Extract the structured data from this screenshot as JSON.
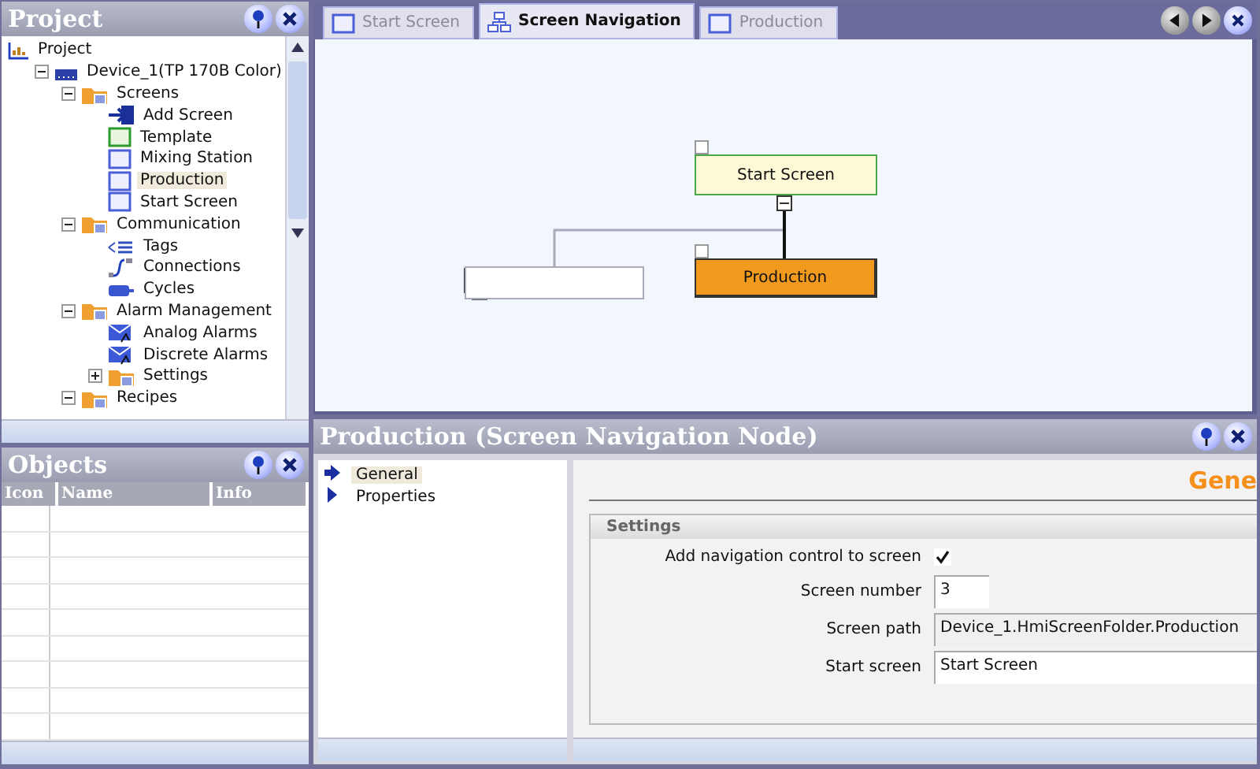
{
  "project_panel": {
    "title": "Project",
    "tree": [
      {
        "label": "Project",
        "kind": "project",
        "selected": false,
        "children": [
          {
            "label": "Device_1(TP 170B Color)",
            "kind": "device",
            "selected": false,
            "expanded": true,
            "children": [
              {
                "label": "Screens",
                "kind": "folder",
                "selected": false,
                "expanded": true,
                "children": [
                  {
                    "label": "Add Screen",
                    "kind": "add",
                    "selected": false
                  },
                  {
                    "label": "Template",
                    "kind": "template",
                    "selected": false
                  },
                  {
                    "label": "Mixing Station",
                    "kind": "screen",
                    "selected": false
                  },
                  {
                    "label": "Production",
                    "kind": "screen",
                    "selected": true
                  },
                  {
                    "label": "Start Screen",
                    "kind": "screen",
                    "selected": false
                  }
                ]
              },
              {
                "label": "Communication",
                "kind": "folder",
                "selected": false,
                "expanded": true,
                "children": [
                  {
                    "label": "Tags",
                    "kind": "tags",
                    "selected": false
                  },
                  {
                    "label": "Connections",
                    "kind": "connections",
                    "selected": false
                  },
                  {
                    "label": "Cycles",
                    "kind": "cycles",
                    "selected": false
                  }
                ]
              },
              {
                "label": "Alarm Management",
                "kind": "folder",
                "selected": false,
                "expanded": true,
                "children": [
                  {
                    "label": "Analog Alarms",
                    "kind": "alarm",
                    "selected": false
                  },
                  {
                    "label": "Discrete Alarms",
                    "kind": "alarm",
                    "selected": false
                  },
                  {
                    "label": "Settings",
                    "kind": "folder",
                    "selected": false,
                    "expanded": false
                  }
                ]
              },
              {
                "label": "Recipes",
                "kind": "folder",
                "selected": false,
                "expanded": true
              }
            ]
          }
        ]
      }
    ]
  },
  "objects_panel": {
    "title": "Objects",
    "columns": [
      "Icon",
      "Name",
      "Info"
    ]
  },
  "tabs": [
    {
      "label": "Start Screen",
      "kind": "screen",
      "selected": false
    },
    {
      "label": "Screen Navigation",
      "kind": "navigation",
      "selected": true
    },
    {
      "label": "Production",
      "kind": "screen",
      "selected": false
    }
  ],
  "navigation": {
    "nodes": [
      {
        "label": "Start Screen",
        "kind": "start"
      },
      {
        "label": "Production",
        "kind": "selected"
      },
      {
        "kind": "empty"
      }
    ]
  },
  "properties_panel": {
    "title": "Production (Screen Navigation Node)",
    "nav": [
      {
        "label": "General",
        "selected": true
      },
      {
        "label": "Properties",
        "selected": false
      }
    ],
    "heading": "Gene",
    "group": "Settings",
    "fields": [
      {
        "label": "Add navigation control to screen",
        "kind": "checkbox",
        "checked": true
      },
      {
        "label": "Screen number",
        "kind": "short",
        "value": "3"
      },
      {
        "label": "Screen path",
        "kind": "readonly",
        "value": "Device_1.HmiScreenFolder.Production"
      },
      {
        "label": "Start screen",
        "kind": "long",
        "value": "Start Screen"
      }
    ]
  }
}
